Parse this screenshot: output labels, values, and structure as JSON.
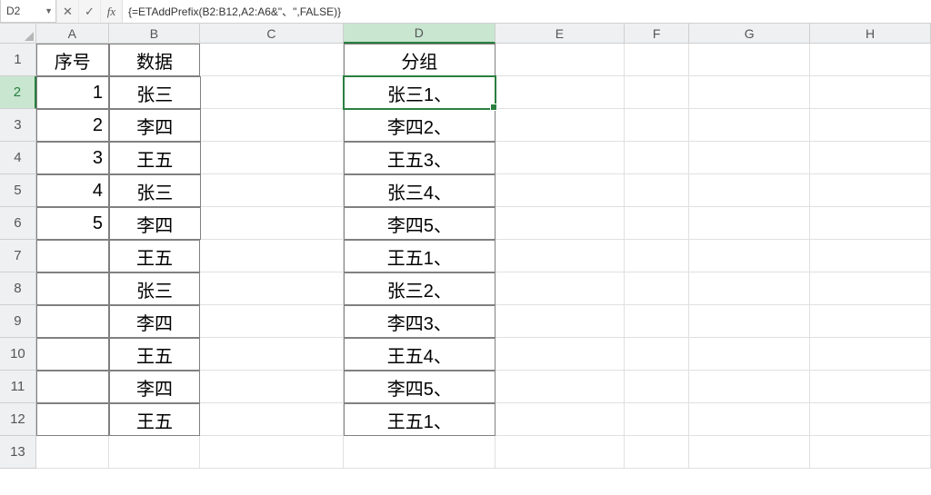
{
  "formula_bar": {
    "name_box": "D2",
    "cancel": "✕",
    "enter": "✓",
    "fx": "fx",
    "formula": "{=ETAddPrefix(B2:B12,A2:A6&\"、\",FALSE)}"
  },
  "columns": [
    "A",
    "B",
    "C",
    "D",
    "E",
    "F",
    "G",
    "H"
  ],
  "row_numbers": [
    "1",
    "2",
    "3",
    "4",
    "5",
    "6",
    "7",
    "8",
    "9",
    "10",
    "11",
    "12",
    "13"
  ],
  "selected_cell": "D2",
  "data": {
    "A": [
      "序号",
      "1",
      "2",
      "3",
      "4",
      "5",
      "",
      "",
      "",
      "",
      "",
      "",
      ""
    ],
    "B": [
      "数据",
      "张三",
      "李四",
      "王五",
      "张三",
      "李四",
      "王五",
      "张三",
      "李四",
      "王五",
      "李四",
      "王五",
      ""
    ],
    "C": [
      "",
      "",
      "",
      "",
      "",
      "",
      "",
      "",
      "",
      "",
      "",
      "",
      ""
    ],
    "D": [
      "分组",
      "张三1、",
      "李四2、",
      "王五3、",
      "张三4、",
      "李四5、",
      "王五1、",
      "张三2、",
      "李四3、",
      "王五4、",
      "李四5、",
      "王五1、",
      ""
    ],
    "E": [
      "",
      "",
      "",
      "",
      "",
      "",
      "",
      "",
      "",
      "",
      "",
      "",
      ""
    ],
    "F": [
      "",
      "",
      "",
      "",
      "",
      "",
      "",
      "",
      "",
      "",
      "",
      "",
      ""
    ],
    "G": [
      "",
      "",
      "",
      "",
      "",
      "",
      "",
      "",
      "",
      "",
      "",
      "",
      ""
    ],
    "H": [
      "",
      "",
      "",
      "",
      "",
      "",
      "",
      "",
      "",
      "",
      "",
      "",
      ""
    ]
  },
  "bordered_cols": [
    "A",
    "B",
    "D"
  ],
  "bordered_rows_max": 12,
  "numeric_right_align": {
    "col": "A",
    "rows_from": 2,
    "rows_to": 6
  }
}
